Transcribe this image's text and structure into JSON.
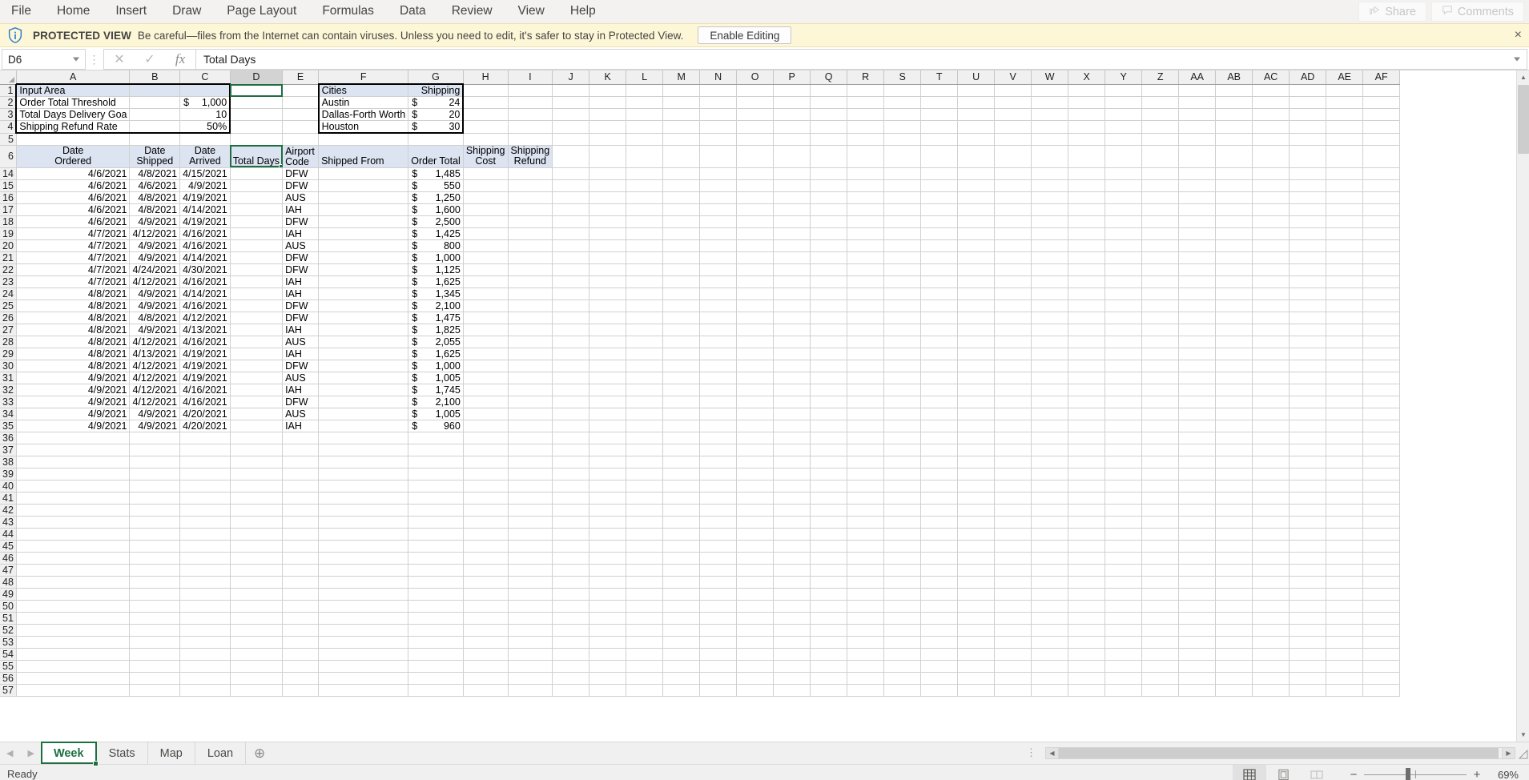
{
  "menubar": {
    "items": [
      "File",
      "Home",
      "Insert",
      "Draw",
      "Page Layout",
      "Formulas",
      "Data",
      "Review",
      "View",
      "Help"
    ],
    "share_label": "Share",
    "comments_label": "Comments"
  },
  "protected_view": {
    "title": "PROTECTED VIEW",
    "message": "Be careful—files from the Internet can contain viruses. Unless you need to edit, it's safer to stay in Protected View.",
    "enable_label": "Enable Editing",
    "close_label": "×",
    "bg_color": "#fdf7d7"
  },
  "formula_bar": {
    "name_box": "D6",
    "cancel_label": "✕",
    "enter_label": "✓",
    "fx_label": "fx",
    "value": "Total Days"
  },
  "grid": {
    "columns": [
      "A",
      "B",
      "C",
      "D",
      "E",
      "F",
      "G",
      "H",
      "I",
      "J",
      "K",
      "L",
      "M",
      "N",
      "O",
      "P",
      "Q",
      "R",
      "S",
      "T",
      "U",
      "V",
      "W",
      "X",
      "Y",
      "Z",
      "AA",
      "AB",
      "AC",
      "AD",
      "AE",
      "AF"
    ],
    "selected_column": "D",
    "active_cell": "D6",
    "input_area": {
      "title": "Input Area",
      "rows": [
        {
          "label": "Order Total Threshold",
          "symbol": "$",
          "value": "1,000"
        },
        {
          "label": "Total Days Delivery Goa",
          "symbol": "",
          "value": "10"
        },
        {
          "label": "Shipping Refund Rate",
          "symbol": "",
          "value": "50%"
        }
      ]
    },
    "cities_table": {
      "header_city": "Cities",
      "header_shipping": "Shipping",
      "rows": [
        {
          "city": "Austin",
          "symbol": "$",
          "shipping": "24"
        },
        {
          "city": "Dallas-Forth Worth",
          "symbol": "$",
          "shipping": "20"
        },
        {
          "city": "Houston",
          "symbol": "$",
          "shipping": "30"
        }
      ]
    },
    "table_headers": {
      "date_ordered": [
        "Date",
        "Ordered"
      ],
      "date_shipped": [
        "Date",
        "Shipped"
      ],
      "date_arrived": [
        "Date",
        "Arrived"
      ],
      "total_days": "Total Days",
      "airport_code": [
        "Airport",
        "Code"
      ],
      "shipped_from": "Shipped From",
      "order_total": "Order Total",
      "shipping_cost": [
        "Shipping",
        "Cost"
      ],
      "shipping_refund": [
        "Shipping",
        "Refund"
      ]
    },
    "data_rows": [
      {
        "row": "14",
        "ordered": "4/6/2021",
        "shipped": "4/8/2021",
        "arrived": "4/15/2021",
        "total_days": "",
        "airport": "DFW",
        "shipped_from": "",
        "symbol": "$",
        "order_total": "1,485",
        "cost": "",
        "refund": ""
      },
      {
        "row": "15",
        "ordered": "4/6/2021",
        "shipped": "4/6/2021",
        "arrived": "4/9/2021",
        "total_days": "",
        "airport": "DFW",
        "shipped_from": "",
        "symbol": "$",
        "order_total": "550",
        "cost": "",
        "refund": ""
      },
      {
        "row": "16",
        "ordered": "4/6/2021",
        "shipped": "4/8/2021",
        "arrived": "4/19/2021",
        "total_days": "",
        "airport": "AUS",
        "shipped_from": "",
        "symbol": "$",
        "order_total": "1,250",
        "cost": "",
        "refund": ""
      },
      {
        "row": "17",
        "ordered": "4/6/2021",
        "shipped": "4/8/2021",
        "arrived": "4/14/2021",
        "total_days": "",
        "airport": "IAH",
        "shipped_from": "",
        "symbol": "$",
        "order_total": "1,600",
        "cost": "",
        "refund": ""
      },
      {
        "row": "18",
        "ordered": "4/6/2021",
        "shipped": "4/9/2021",
        "arrived": "4/19/2021",
        "total_days": "",
        "airport": "DFW",
        "shipped_from": "",
        "symbol": "$",
        "order_total": "2,500",
        "cost": "",
        "refund": ""
      },
      {
        "row": "19",
        "ordered": "4/7/2021",
        "shipped": "4/12/2021",
        "arrived": "4/16/2021",
        "total_days": "",
        "airport": "IAH",
        "shipped_from": "",
        "symbol": "$",
        "order_total": "1,425",
        "cost": "",
        "refund": ""
      },
      {
        "row": "20",
        "ordered": "4/7/2021",
        "shipped": "4/9/2021",
        "arrived": "4/16/2021",
        "total_days": "",
        "airport": "AUS",
        "shipped_from": "",
        "symbol": "$",
        "order_total": "800",
        "cost": "",
        "refund": ""
      },
      {
        "row": "21",
        "ordered": "4/7/2021",
        "shipped": "4/9/2021",
        "arrived": "4/14/2021",
        "total_days": "",
        "airport": "DFW",
        "shipped_from": "",
        "symbol": "$",
        "order_total": "1,000",
        "cost": "",
        "refund": ""
      },
      {
        "row": "22",
        "ordered": "4/7/2021",
        "shipped": "4/24/2021",
        "arrived": "4/30/2021",
        "total_days": "",
        "airport": "DFW",
        "shipped_from": "",
        "symbol": "$",
        "order_total": "1,125",
        "cost": "",
        "refund": ""
      },
      {
        "row": "23",
        "ordered": "4/7/2021",
        "shipped": "4/12/2021",
        "arrived": "4/16/2021",
        "total_days": "",
        "airport": "IAH",
        "shipped_from": "",
        "symbol": "$",
        "order_total": "1,625",
        "cost": "",
        "refund": ""
      },
      {
        "row": "24",
        "ordered": "4/8/2021",
        "shipped": "4/9/2021",
        "arrived": "4/14/2021",
        "total_days": "",
        "airport": "IAH",
        "shipped_from": "",
        "symbol": "$",
        "order_total": "1,345",
        "cost": "",
        "refund": ""
      },
      {
        "row": "25",
        "ordered": "4/8/2021",
        "shipped": "4/9/2021",
        "arrived": "4/16/2021",
        "total_days": "",
        "airport": "DFW",
        "shipped_from": "",
        "symbol": "$",
        "order_total": "2,100",
        "cost": "",
        "refund": ""
      },
      {
        "row": "26",
        "ordered": "4/8/2021",
        "shipped": "4/8/2021",
        "arrived": "4/12/2021",
        "total_days": "",
        "airport": "DFW",
        "shipped_from": "",
        "symbol": "$",
        "order_total": "1,475",
        "cost": "",
        "refund": ""
      },
      {
        "row": "27",
        "ordered": "4/8/2021",
        "shipped": "4/9/2021",
        "arrived": "4/13/2021",
        "total_days": "",
        "airport": "IAH",
        "shipped_from": "",
        "symbol": "$",
        "order_total": "1,825",
        "cost": "",
        "refund": ""
      },
      {
        "row": "28",
        "ordered": "4/8/2021",
        "shipped": "4/12/2021",
        "arrived": "4/16/2021",
        "total_days": "",
        "airport": "AUS",
        "shipped_from": "",
        "symbol": "$",
        "order_total": "2,055",
        "cost": "",
        "refund": ""
      },
      {
        "row": "29",
        "ordered": "4/8/2021",
        "shipped": "4/13/2021",
        "arrived": "4/19/2021",
        "total_days": "",
        "airport": "IAH",
        "shipped_from": "",
        "symbol": "$",
        "order_total": "1,625",
        "cost": "",
        "refund": ""
      },
      {
        "row": "30",
        "ordered": "4/8/2021",
        "shipped": "4/12/2021",
        "arrived": "4/19/2021",
        "total_days": "",
        "airport": "DFW",
        "shipped_from": "",
        "symbol": "$",
        "order_total": "1,000",
        "cost": "",
        "refund": ""
      },
      {
        "row": "31",
        "ordered": "4/9/2021",
        "shipped": "4/12/2021",
        "arrived": "4/19/2021",
        "total_days": "",
        "airport": "AUS",
        "shipped_from": "",
        "symbol": "$",
        "order_total": "1,005",
        "cost": "",
        "refund": ""
      },
      {
        "row": "32",
        "ordered": "4/9/2021",
        "shipped": "4/12/2021",
        "arrived": "4/16/2021",
        "total_days": "",
        "airport": "IAH",
        "shipped_from": "",
        "symbol": "$",
        "order_total": "1,745",
        "cost": "",
        "refund": ""
      },
      {
        "row": "33",
        "ordered": "4/9/2021",
        "shipped": "4/12/2021",
        "arrived": "4/16/2021",
        "total_days": "",
        "airport": "DFW",
        "shipped_from": "",
        "symbol": "$",
        "order_total": "2,100",
        "cost": "",
        "refund": ""
      },
      {
        "row": "34",
        "ordered": "4/9/2021",
        "shipped": "4/9/2021",
        "arrived": "4/20/2021",
        "total_days": "",
        "airport": "AUS",
        "shipped_from": "",
        "symbol": "$",
        "order_total": "1,005",
        "cost": "",
        "refund": ""
      },
      {
        "row": "35",
        "ordered": "4/9/2021",
        "shipped": "4/9/2021",
        "arrived": "4/20/2021",
        "total_days": "",
        "airport": "IAH",
        "shipped_from": "",
        "symbol": "$",
        "order_total": "960",
        "cost": "",
        "refund": ""
      }
    ],
    "empty_row_numbers": [
      "36",
      "37",
      "38",
      "39",
      "40",
      "41",
      "42",
      "43",
      "44",
      "45",
      "46",
      "47",
      "48",
      "49",
      "50",
      "51",
      "52",
      "53",
      "54",
      "55",
      "56",
      "57"
    ],
    "header_row_numbers": {
      "r1": "1",
      "r2": "2",
      "r3": "3",
      "r4": "4",
      "r5": "5",
      "r6": "6"
    }
  },
  "sheet_tabs": {
    "tabs": [
      "Week",
      "Stats",
      "Map",
      "Loan"
    ],
    "active": "Week",
    "add_label": "⊕"
  },
  "status_bar": {
    "status": "Ready",
    "zoom": "69%",
    "zoom_out": "−",
    "zoom_in": "+"
  },
  "colors": {
    "accent": "#1d6f42",
    "header_fill": "#dce3f1",
    "protected_bg": "#fdf7d7"
  }
}
